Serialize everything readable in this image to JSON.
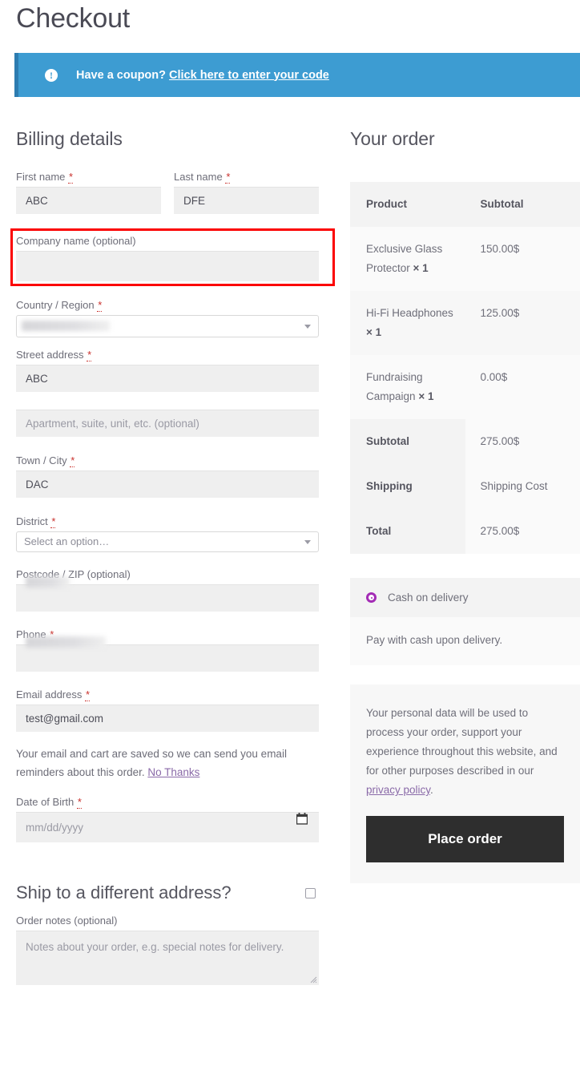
{
  "page": {
    "title": "Checkout"
  },
  "coupon": {
    "icon": "exclamation-circle-icon",
    "prompt": "Have a coupon?",
    "link": "Click here to enter your code",
    "bar_color": "#3d9cd2",
    "bar_border_color": "#2d7cb0"
  },
  "billing": {
    "heading": "Billing details",
    "required_mark": "*",
    "fields": {
      "first_name": {
        "label": "First name",
        "value": "ABC",
        "required": true
      },
      "last_name": {
        "label": "Last name",
        "value": "DFE",
        "required": true
      },
      "company": {
        "label": "Company name (optional)",
        "value": "",
        "required": false,
        "highlighted": true,
        "highlight_color": "#fb0000"
      },
      "country": {
        "label": "Country / Region",
        "value": "",
        "required": true,
        "redacted": true,
        "control": "select"
      },
      "street": {
        "label": "Street address",
        "value": "ABC",
        "required": true
      },
      "apartment": {
        "label": "",
        "value": "",
        "placeholder": "Apartment, suite, unit, etc. (optional)",
        "required": false
      },
      "city": {
        "label": "Town / City",
        "value": "DAC",
        "required": true
      },
      "district": {
        "label": "District",
        "value": "Select an option…",
        "required": true,
        "control": "select"
      },
      "postcode": {
        "label": "Postcode / ZIP (optional)",
        "value": "",
        "required": false,
        "redacted": true
      },
      "phone": {
        "label": "Phone",
        "value": "",
        "required": true,
        "redacted": true
      },
      "email": {
        "label": "Email address",
        "value": "test@gmail.com",
        "required": true
      },
      "dob": {
        "label": "Date of Birth",
        "value": "",
        "placeholder": "mm/dd/yyyy",
        "required": true,
        "icon": "calendar-icon"
      }
    },
    "email_note": "Your email and cart are saved so we can send you email reminders about this order.",
    "email_note_link": "No Thanks"
  },
  "shipping_section": {
    "title": "Ship to a different address?",
    "checked": false
  },
  "order_notes": {
    "label": "Order notes (optional)",
    "placeholder": "Notes about your order, e.g. special notes for delivery."
  },
  "order": {
    "heading": "Your order",
    "columns": [
      "Product",
      "Subtotal"
    ],
    "items": [
      {
        "name": "Exclusive Glass Protector",
        "qty": "× 1",
        "subtotal": "150.00$"
      },
      {
        "name": "Hi-Fi Headphones",
        "qty": "× 1",
        "subtotal": "125.00$"
      },
      {
        "name": "Fundraising Campaign",
        "qty": "× 1",
        "subtotal": "0.00$"
      }
    ],
    "totals": [
      {
        "label": "Subtotal",
        "value": "275.00$",
        "bold_value": false
      },
      {
        "label": "Shipping",
        "value": "Shipping Cost",
        "bold_value": false
      },
      {
        "label": "Total",
        "value": "275.00$",
        "bold_value": true
      }
    ]
  },
  "payment": {
    "method_label": "Cash on delivery",
    "selected": true,
    "radio_color": "#a32bb5",
    "description": "Pay with cash upon delivery."
  },
  "privacy": {
    "text_before": "Your personal data will be used to process your order, support your experience throughout this website, and for other purposes described in our ",
    "link": "privacy policy",
    "text_after": ".",
    "place_order_label": "Place order",
    "button_color": "#2e2e2e"
  }
}
